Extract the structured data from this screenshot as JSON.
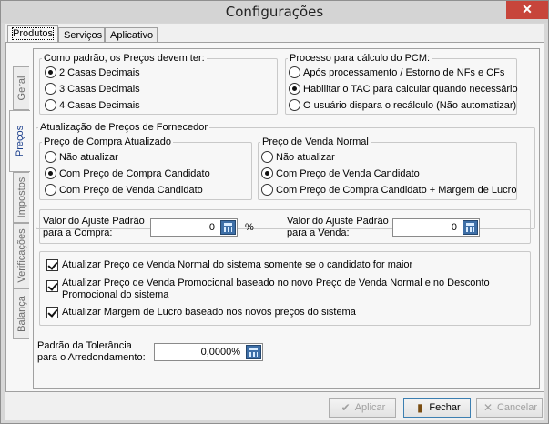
{
  "window": {
    "title": "Configurações",
    "close_glyph": "✕"
  },
  "top_tabs": [
    {
      "label": "Produtos",
      "active": true
    },
    {
      "label": "Serviços",
      "active": false
    },
    {
      "label": "Aplicativo",
      "active": false
    }
  ],
  "side_tabs": [
    {
      "label": "Geral",
      "active": false
    },
    {
      "label": "Preços",
      "active": true
    },
    {
      "label": "Impostos",
      "active": false
    },
    {
      "label": "Verificações",
      "active": false
    },
    {
      "label": "Balança",
      "active": false
    }
  ],
  "casas_decimais": {
    "legend": "Como padrão, os Preços devem ter:",
    "options": [
      "2 Casas Decimais",
      "3 Casas Decimais",
      "4 Casas Decimais"
    ],
    "selected": "2 Casas Decimais"
  },
  "processo_pcm": {
    "legend": "Processo para cálculo do PCM:",
    "options": [
      "Após processamento / Estorno de NFs e CFs",
      "Habilitar o TAC para calcular quando necessário",
      "O usuário dispara o recálculo (Não automatizar)"
    ],
    "selected": "Habilitar o TAC para calcular quando necessário"
  },
  "atualizacao": {
    "legend": "Atualização de Preços de Fornecedor",
    "compra": {
      "legend": "Preço de Compra Atualizado",
      "options": [
        "Não atualizar",
        "Com Preço de Compra Candidato",
        "Com Preço de Venda Candidato"
      ],
      "selected": "Com Preço de Compra Candidato"
    },
    "venda": {
      "legend": "Preço de Venda Normal",
      "options": [
        "Não atualizar",
        "Com Preço de Venda Candidato",
        "Com Preço de Compra Candidato + Margem de Lucro"
      ],
      "selected": "Com Preço de Venda Candidato"
    }
  },
  "ajuste": {
    "compra_label_1": "Valor do Ajuste Padrão",
    "compra_label_2": "para a Compra:",
    "compra_value": "0",
    "percent": "%",
    "venda_label_1": "Valor do Ajuste Padrão",
    "venda_label_2": "para a Venda:",
    "venda_value": "0"
  },
  "checks": [
    {
      "label": "Atualizar Preço de Venda Normal do sistema somente se o candidato for maior",
      "checked": true
    },
    {
      "label": "Atualizar Preço de Venda Promocional baseado no novo Preço de Venda Normal e no Desconto Promocional do sistema",
      "checked": true
    },
    {
      "label": "Atualizar Margem de Lucro baseado nos novos preços do sistema",
      "checked": true
    }
  ],
  "tolerancia": {
    "label_1": "Padrão da Tolerância",
    "label_2": "para o Arredondamento:",
    "value": "0,0000%"
  },
  "footer": {
    "apply": "Aplicar",
    "close": "Fechar",
    "cancel": "Cancelar"
  }
}
